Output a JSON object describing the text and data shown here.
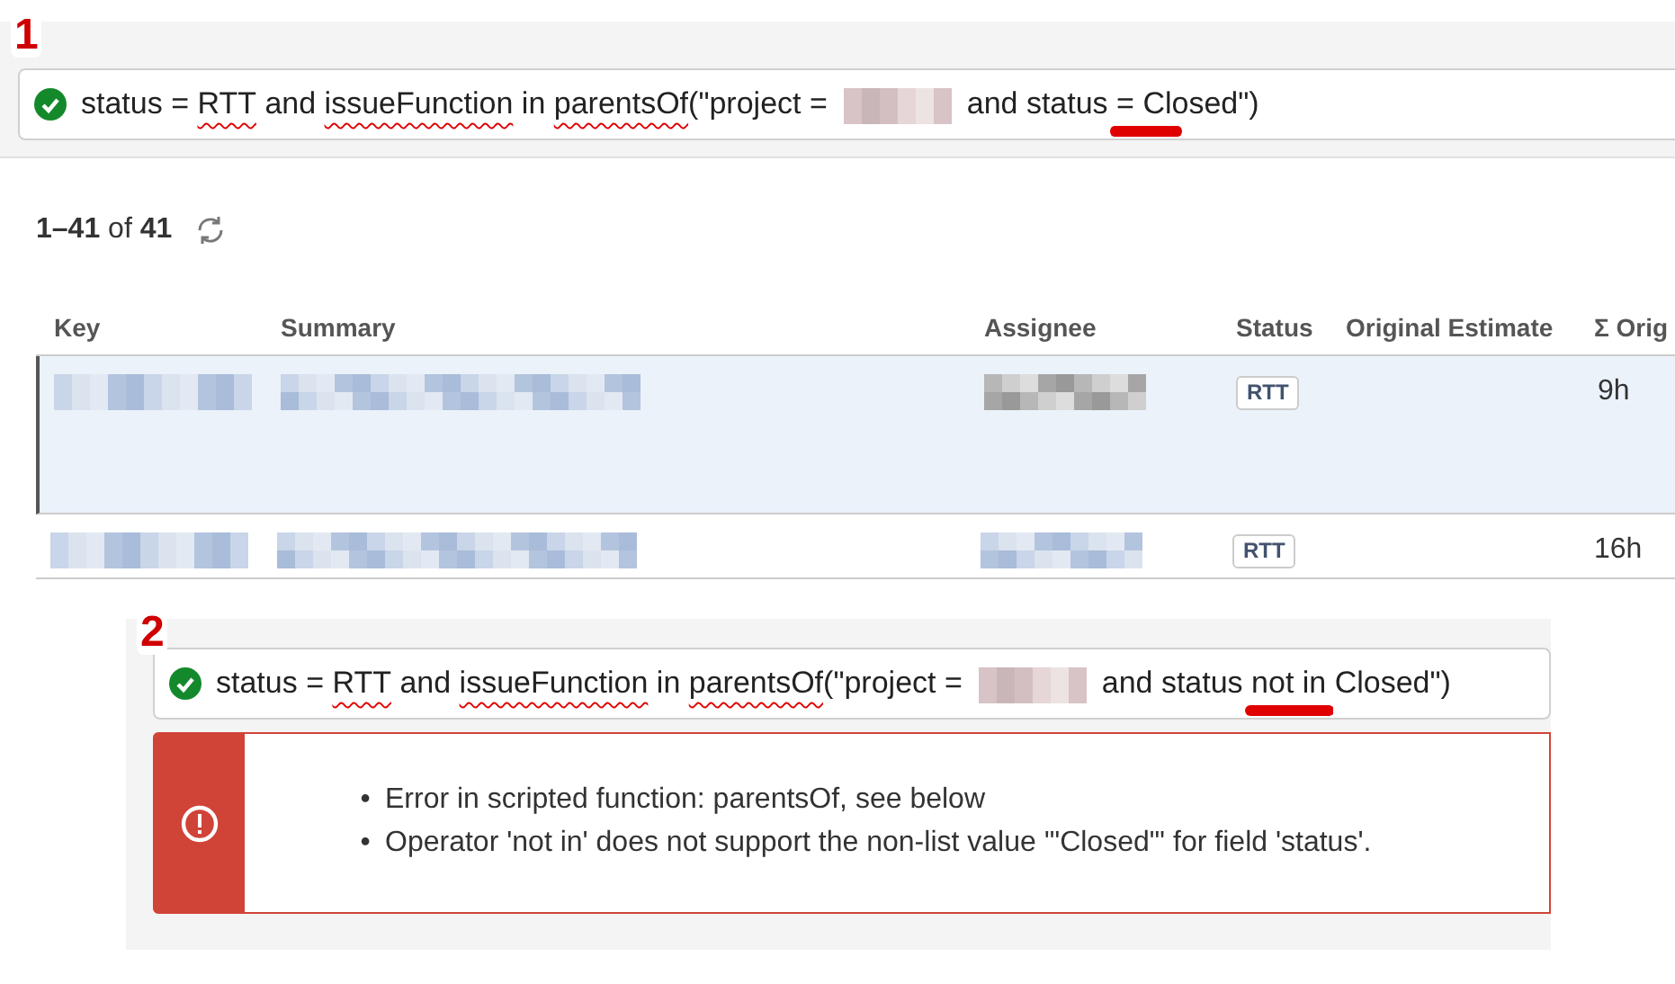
{
  "query_1": {
    "number": "1",
    "valid": true,
    "segments": [
      {
        "kind": "text",
        "text": "status = ",
        "misspelled": false
      },
      {
        "kind": "text",
        "text": "RTT",
        "misspelled": true
      },
      {
        "kind": "text",
        "text": " and ",
        "misspelled": false
      },
      {
        "kind": "text",
        "text": "issueFunction",
        "misspelled": true
      },
      {
        "kind": "text",
        "text": " in ",
        "misspelled": false
      },
      {
        "kind": "text",
        "text": "parentsOf",
        "misspelled": true
      },
      {
        "kind": "text",
        "text": "(\"project = ",
        "misspelled": false
      },
      {
        "kind": "redacted"
      },
      {
        "kind": "text",
        "text": " and status ",
        "misspelled": false
      },
      {
        "kind": "marked",
        "text": "="
      },
      {
        "kind": "text",
        "text": " Closed\")",
        "misspelled": false
      }
    ]
  },
  "results": {
    "range": "1–41",
    "of": "of",
    "total": "41"
  },
  "table": {
    "columns": [
      "Key",
      "Summary",
      "Assignee",
      "Status",
      "Original Estimate",
      "Σ Orig"
    ],
    "rows": [
      {
        "selected": true,
        "status": "RTT",
        "column_6": "9h"
      },
      {
        "selected": false,
        "status": "RTT",
        "column_6": "16h"
      }
    ]
  },
  "query_2": {
    "number": "2",
    "valid": true,
    "segments": [
      {
        "kind": "text",
        "text": "status = ",
        "misspelled": false
      },
      {
        "kind": "text",
        "text": "RTT",
        "misspelled": true
      },
      {
        "kind": "text",
        "text": " and ",
        "misspelled": false
      },
      {
        "kind": "text",
        "text": "issueFunction",
        "misspelled": true
      },
      {
        "kind": "text",
        "text": " in ",
        "misspelled": false
      },
      {
        "kind": "text",
        "text": "parentsOf",
        "misspelled": true
      },
      {
        "kind": "text",
        "text": "(\"project = ",
        "misspelled": false
      },
      {
        "kind": "redacted"
      },
      {
        "kind": "text",
        "text": " and status ",
        "misspelled": false
      },
      {
        "kind": "marked",
        "text": "not in"
      },
      {
        "kind": "text",
        "text": " Closed\")",
        "misspelled": false
      }
    ],
    "errors": [
      {
        "bullet": "•",
        "text": "Error in scripted function: parentsOf, see below"
      },
      {
        "bullet": "•",
        "text": "Operator 'not in' does not support the non-list value '\"Closed\"' for field 'status'."
      }
    ]
  }
}
